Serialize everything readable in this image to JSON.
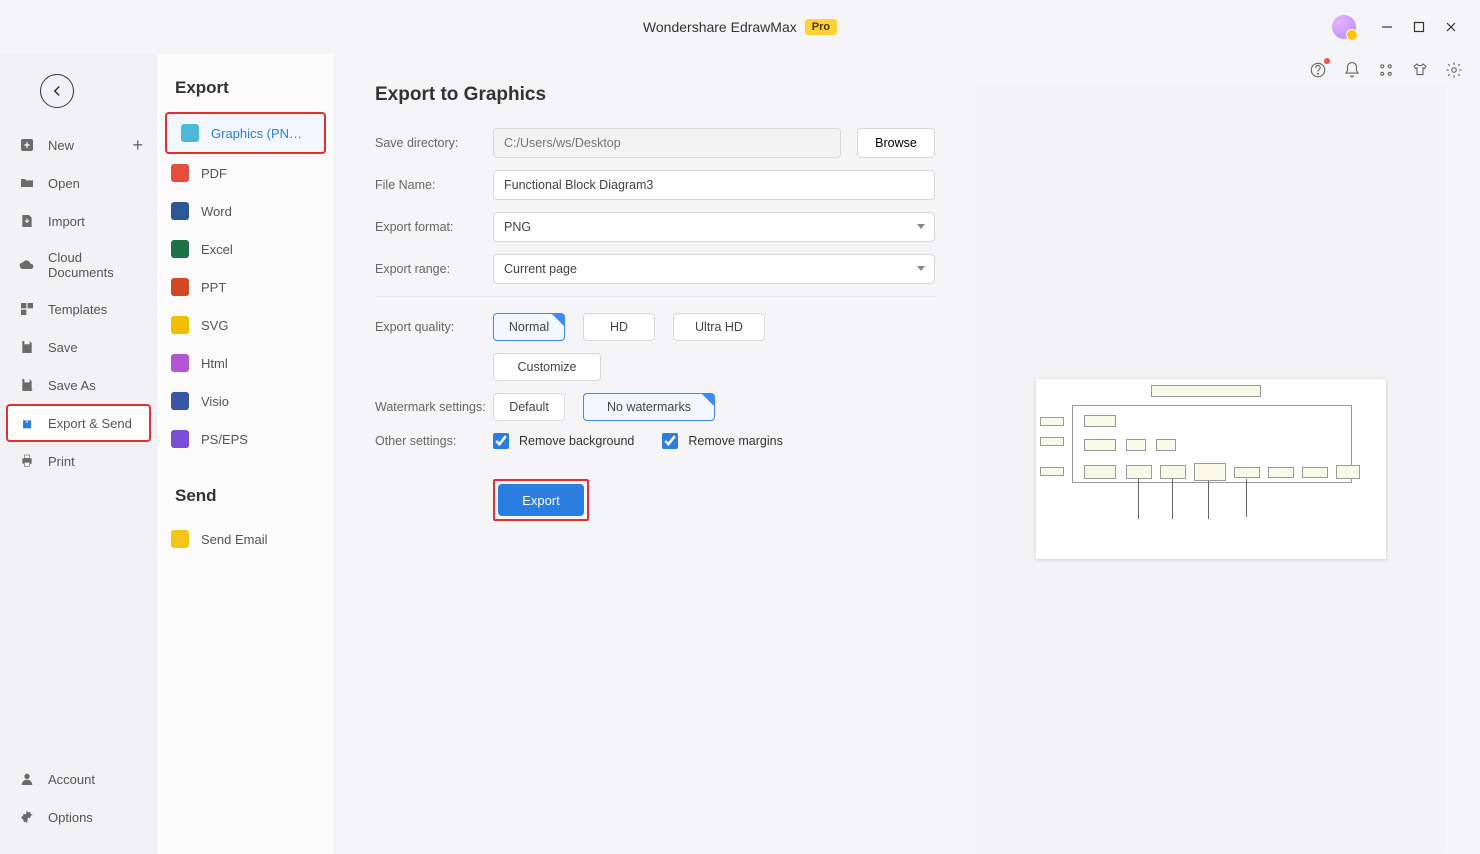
{
  "app": {
    "title": "Wondershare EdrawMax",
    "badge": "Pro"
  },
  "nav": {
    "new": "New",
    "open": "Open",
    "import": "Import",
    "cloud": "Cloud Documents",
    "templates": "Templates",
    "save": "Save",
    "saveas": "Save As",
    "export": "Export & Send",
    "print": "Print",
    "account": "Account",
    "options": "Options"
  },
  "exportSec": {
    "title": "Export",
    "graphics": "Graphics (PNG, JPG e...",
    "pdf": "PDF",
    "word": "Word",
    "excel": "Excel",
    "ppt": "PPT",
    "svg": "SVG",
    "html": "Html",
    "visio": "Visio",
    "pseps": "PS/EPS"
  },
  "sendSec": {
    "title": "Send",
    "email": "Send Email"
  },
  "form": {
    "title": "Export to Graphics",
    "savedir_label": "Save directory:",
    "savedir_ph": "C:/Users/ws/Desktop",
    "browse": "Browse",
    "filename_label": "File Name:",
    "filename": "Functional Block Diagram3",
    "format_label": "Export format:",
    "format": "PNG",
    "range_label": "Export range:",
    "range": "Current page",
    "quality_label": "Export quality:",
    "q_normal": "Normal",
    "q_hd": "HD",
    "q_uhd": "Ultra HD",
    "q_custom": "Customize",
    "wm_label": "Watermark settings:",
    "wm_default": "Default",
    "wm_none": "No watermarks",
    "other_label": "Other settings:",
    "rm_bg": "Remove background",
    "rm_margin": "Remove margins",
    "export_btn": "Export"
  }
}
